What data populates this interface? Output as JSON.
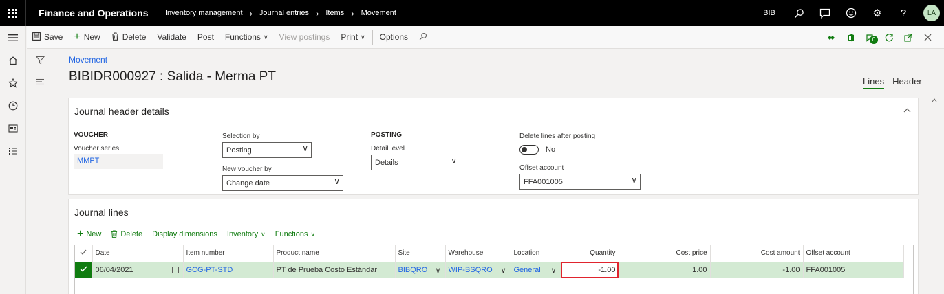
{
  "topbar": {
    "app_name": "Finance and Operations",
    "breadcrumbs": [
      "Inventory management",
      "Journal entries",
      "Items",
      "Movement"
    ],
    "company": "BIB",
    "user_initials": "LA"
  },
  "actionpane": {
    "save": "Save",
    "new": "New",
    "delete": "Delete",
    "validate": "Validate",
    "post": "Post",
    "functions": "Functions",
    "view_postings": "View postings",
    "print": "Print",
    "options": "Options",
    "notification_count": "0"
  },
  "page": {
    "breadcrumb": "Movement",
    "title": "BIBIDR000927 : Salida - Merma PT",
    "tabs": [
      "Lines",
      "Header"
    ]
  },
  "header_details": {
    "title": "Journal header details",
    "voucher": {
      "group_title": "VOUCHER",
      "series_label": "Voucher series",
      "series_value": "MMPT"
    },
    "selection": {
      "selection_by_label": "Selection by",
      "selection_by_value": "Posting",
      "new_voucher_label": "New voucher by",
      "new_voucher_value": "Change date"
    },
    "posting": {
      "group_title": "POSTING",
      "detail_label": "Detail level",
      "detail_value": "Details"
    },
    "other": {
      "delete_lines_label": "Delete lines after posting",
      "delete_lines_value": "No",
      "offset_label": "Offset account",
      "offset_value": "FFA001005"
    }
  },
  "journal_lines": {
    "title": "Journal lines",
    "toolbar": {
      "new": "New",
      "delete": "Delete",
      "display_dimensions": "Display dimensions",
      "inventory": "Inventory",
      "functions": "Functions"
    },
    "columns": [
      "Date",
      "Item number",
      "Product name",
      "Site",
      "Warehouse",
      "Location",
      "Quantity",
      "Cost price",
      "Cost amount",
      "Offset account"
    ],
    "rows": [
      {
        "date": "06/04/2021",
        "item_number": "GCG-PT-STD",
        "product_name": "PT de Prueba Costo Estándar",
        "site": "BIBQRO",
        "warehouse": "WIP-BSQRO",
        "location": "General",
        "quantity": "-1.00",
        "cost_price": "1.00",
        "cost_amount": "-1.00",
        "offset_account": "FFA001005"
      }
    ]
  },
  "colors": {
    "accent": "#107c10",
    "link": "#2266e3",
    "highlight": "#e0242e",
    "selected_row": "#d3ead3"
  }
}
